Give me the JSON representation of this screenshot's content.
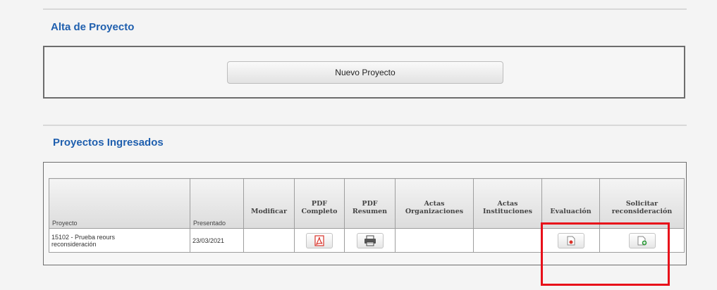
{
  "alta": {
    "title": "Alta de Proyecto",
    "new_button": "Nuevo Proyecto"
  },
  "ingresados": {
    "title": "Proyectos Ingresados",
    "headers": {
      "proyecto": "Proyecto",
      "presentado": "Presentado",
      "modificar": "Modificar",
      "pdf_completo_1": "PDF",
      "pdf_completo_2": "Completo",
      "pdf_resumen_1": "PDF",
      "pdf_resumen_2": "Resumen",
      "actas_org_1": "Actas",
      "actas_org_2": "Organizaciones",
      "actas_inst_1": "Actas",
      "actas_inst_2": "Instituciones",
      "evaluacion": "Evaluación",
      "solicitar_1": "Solicitar",
      "solicitar_2": "reconsideración"
    },
    "rows": [
      {
        "proyecto_line1": "15102 - Prueba reours",
        "proyecto_line2": "reconsideración",
        "presentado": "23/03/2021"
      }
    ]
  },
  "icons": {
    "pdf_completo": "pdf-icon",
    "pdf_resumen": "printer-icon",
    "evaluacion": "pdf-document-icon",
    "solicitar": "add-document-icon"
  },
  "colors": {
    "section_title": "#1f5fae",
    "highlight": "#e8101a",
    "pdf_red": "#d9342b",
    "add_green": "#2e9a3a"
  }
}
